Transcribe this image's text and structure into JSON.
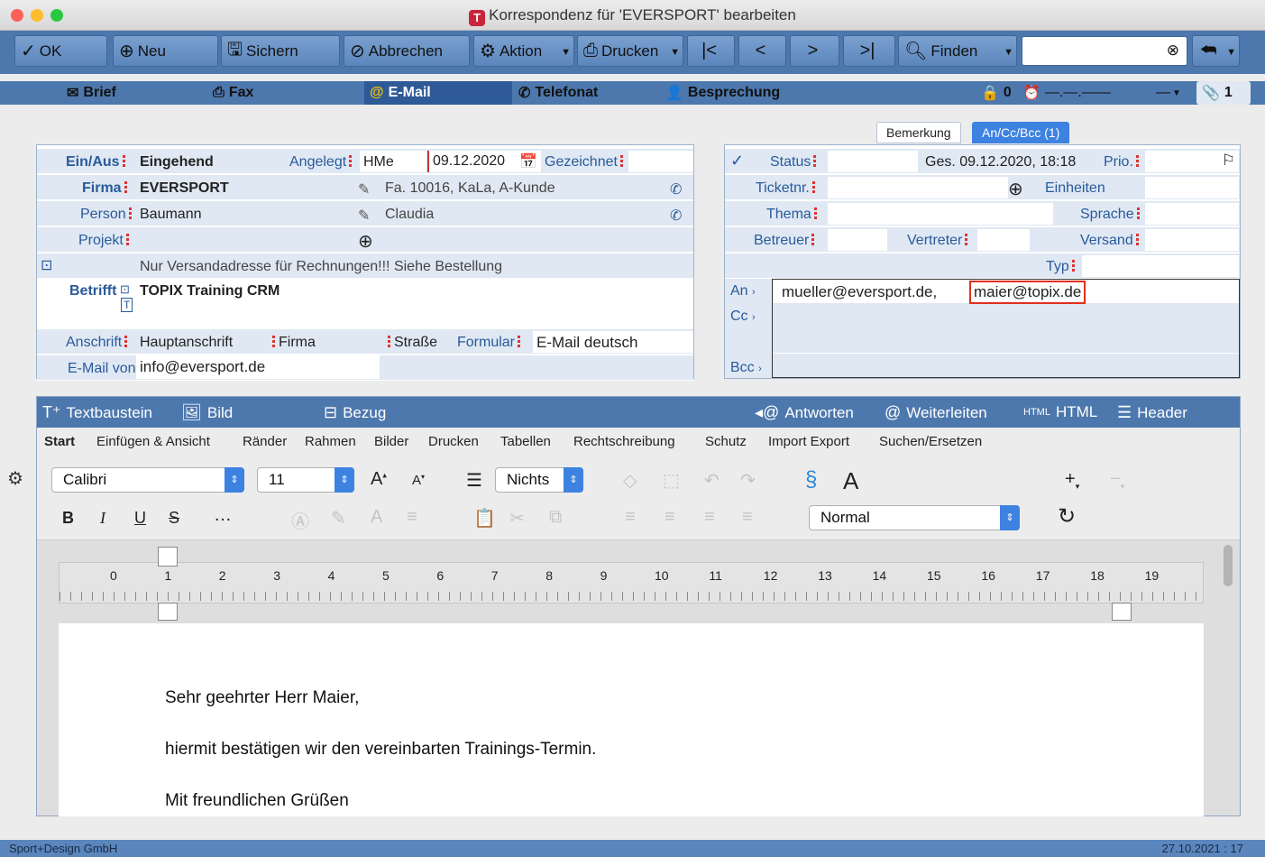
{
  "window": {
    "title": "Korrespondenz für 'EVERSPORT' bearbeiten"
  },
  "toolbar": {
    "ok": "OK",
    "neu": "Neu",
    "sichern": "Sichern",
    "abbrechen": "Abbrechen",
    "aktion": "Aktion",
    "drucken": "Drucken",
    "finden": "Finden",
    "search_value": ""
  },
  "tabs": [
    {
      "label": "Brief"
    },
    {
      "label": "Fax"
    },
    {
      "label": "E-Mail"
    },
    {
      "label": "Telefonat"
    },
    {
      "label": "Besprechung"
    }
  ],
  "tabbar_right": {
    "lock_count": "0",
    "time": "—.—.——",
    "time2": "—",
    "counter": "1"
  },
  "left": {
    "einaus_label": "Ein/Aus",
    "einaus_value": "Eingehend",
    "angelegt_label": "Angelegt",
    "angelegt_value": "HMe",
    "date": "09.12.2020",
    "gezeichnet_label": "Gezeichnet",
    "firma_label": "Firma",
    "firma_value": "EVERSPORT",
    "firma_info": "Fa. 10016, KaLa, A-Kunde",
    "person_label": "Person",
    "person_value": "Baumann",
    "person_first": "Claudia",
    "projekt_label": "Projekt",
    "note": "Nur Versandadresse für Rechnungen!!! Siehe Bestellung",
    "betrifft_label": "Betrifft",
    "betrifft_value": "TOPIX Training CRM",
    "anschrift_label": "Anschrift",
    "anschrift_value": "Hauptanschrift",
    "firma2": "Firma",
    "strasse": "Straße",
    "formular_label": "Formular",
    "formular_value": "E-Mail deutsch",
    "emailvon_label": "E-Mail von",
    "emailvon_value": "info@eversport.de"
  },
  "right": {
    "subtab_bemerkung": "Bemerkung",
    "subtab_ancc": "An/Cc/Bcc (1)",
    "status_label": "Status",
    "ges": "Ges. 09.12.2020, 18:18",
    "prio_label": "Prio.",
    "ticket_label": "Ticketnr.",
    "einheiten": "Einheiten",
    "thema_label": "Thema",
    "sprache_label": "Sprache",
    "betreuer_label": "Betreuer",
    "vertreter_label": "Vertreter",
    "versand_label": "Versand",
    "typ_label": "Typ",
    "an_label": "An",
    "an_value1": "mueller@eversport.de,",
    "an_value2": "maier@topix.de",
    "cc_label": "Cc",
    "bcc_label": "Bcc"
  },
  "editor": {
    "textbaustein": "Textbaustein",
    "bild": "Bild",
    "bezug": "Bezug",
    "antworten": "Antworten",
    "weiterleiten": "Weiterleiten",
    "html": "HTML",
    "header": "Header",
    "ribbon_tabs": [
      "Start",
      "Einfügen & Ansicht",
      "Ränder",
      "Rahmen",
      "Bilder",
      "Drucken",
      "Tabellen",
      "Rechtschreibung",
      "Schutz",
      "Import Export",
      "Suchen/Ersetzen"
    ],
    "font": "Calibri",
    "size": "11",
    "list_style": "Nichts",
    "para_style": "Normal",
    "ruler": [
      "0",
      "1",
      "2",
      "3",
      "4",
      "5",
      "6",
      "7",
      "8",
      "9",
      "10",
      "11",
      "12",
      "13",
      "14",
      "15",
      "16",
      "17",
      "18",
      "19"
    ],
    "lines": [
      "Sehr geehrter Herr Maier,",
      "hiermit bestätigen wir den vereinbarten Trainings-Termin.",
      "Mit freundlichen Grüßen"
    ]
  },
  "status": {
    "company": "Sport+Design GmbH",
    "date": "27.10.2021 : 17"
  },
  "colors": {
    "accent": "#4d78ad",
    "active_tab": "#2e5a97",
    "highlight": "#e0301e"
  }
}
